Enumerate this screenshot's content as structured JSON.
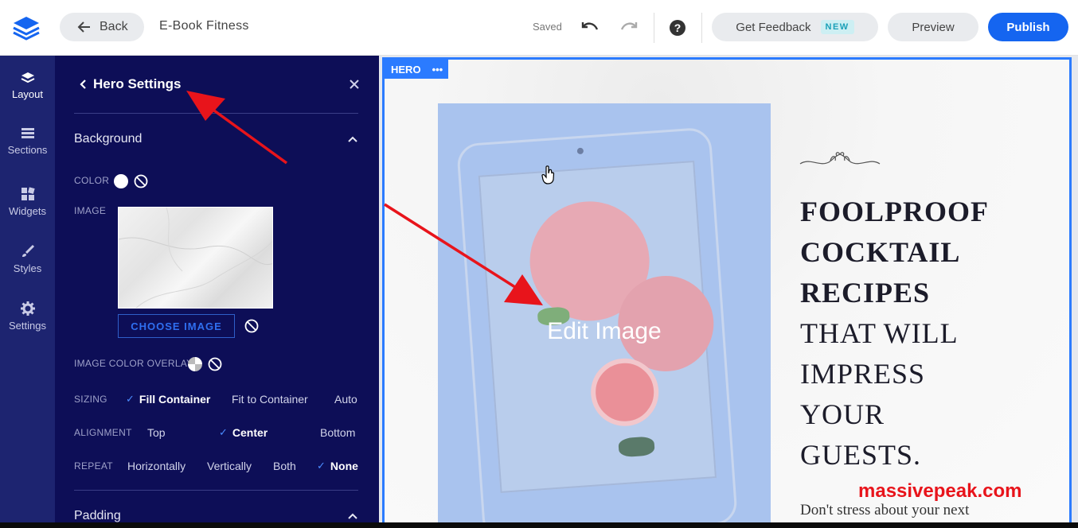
{
  "header": {
    "back_label": "Back",
    "project_title": "E-Book Fitness",
    "saved_label": "Saved",
    "feedback_label": "Get Feedback",
    "new_badge": "NEW",
    "preview_label": "Preview",
    "publish_label": "Publish"
  },
  "rail": {
    "items": [
      {
        "label": "Layout",
        "icon": "layers-icon"
      },
      {
        "label": "Sections",
        "icon": "sections-icon"
      },
      {
        "label": "Widgets",
        "icon": "widgets-icon"
      },
      {
        "label": "Styles",
        "icon": "brush-icon"
      },
      {
        "label": "Settings",
        "icon": "gear-icon"
      }
    ]
  },
  "panel": {
    "title": "Hero Settings",
    "background_heading": "Background",
    "color_label": "COLOR",
    "image_label": "IMAGE",
    "choose_image": "CHOOSE IMAGE",
    "overlay_label": "IMAGE COLOR OVERLAY",
    "sizing_label": "SIZING",
    "sizing_options": [
      "Fill Container",
      "Fit to Container",
      "Auto"
    ],
    "alignment_label": "ALIGNMENT",
    "alignment_options": [
      "Top",
      "Center",
      "Bottom"
    ],
    "repeat_label": "REPEAT",
    "repeat_options": [
      "Horizontally",
      "Vertically",
      "Both",
      "None"
    ],
    "padding_heading": "Padding"
  },
  "canvas": {
    "section_tag": "HERO",
    "section_menu": "•••",
    "edit_image_label": "Edit Image",
    "headline_bold": [
      "FOOLPROOF",
      "COCKTAIL",
      "RECIPES"
    ],
    "headline_regular": [
      "THAT WILL",
      "IMPRESS",
      "YOUR",
      "GUESTS."
    ],
    "subtext": "Don't stress about your next"
  },
  "watermark": "massivepeak.com",
  "colors": {
    "accent": "#1565f0",
    "panel_bg": "#0d0e57",
    "rail_bg": "#1d2470",
    "annotation_arrow": "#e8141b"
  }
}
